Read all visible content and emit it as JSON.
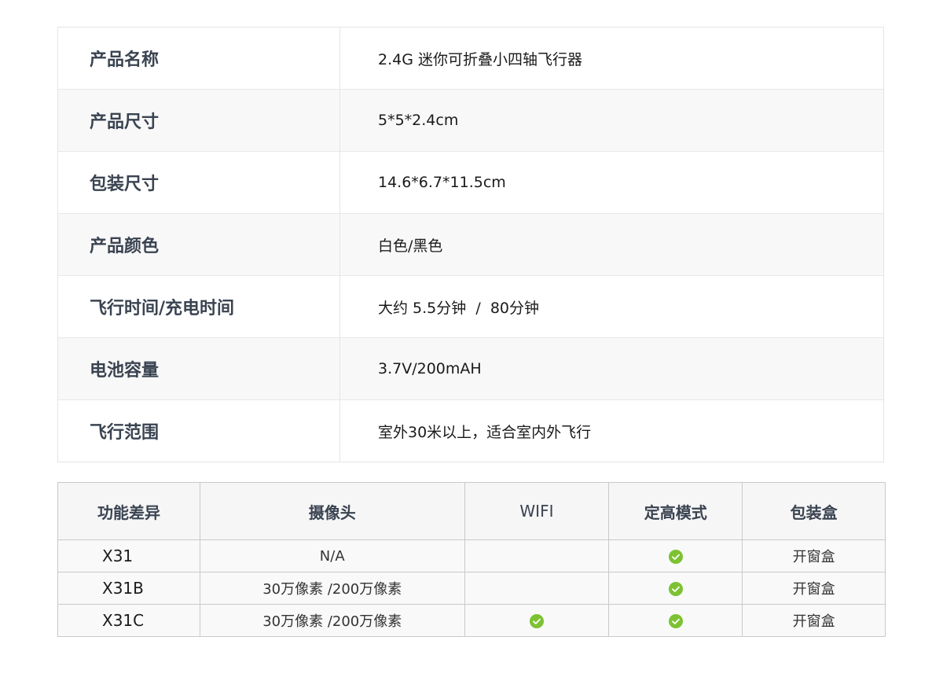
{
  "specs": [
    {
      "label": "产品名称",
      "value": "2.4G 迷你可折叠小四轴飞行器"
    },
    {
      "label": "产品尺寸",
      "value": "5*5*2.4cm"
    },
    {
      "label": "包装尺寸",
      "value": "14.6*6.7*11.5cm"
    },
    {
      "label": "产品颜色",
      "value": "白色/黑色"
    },
    {
      "label": "飞行时间/充电时间",
      "value": "大约 5.5分钟  /  80分钟"
    },
    {
      "label": "电池容量",
      "value": "3.7V/200mAH"
    },
    {
      "label": "飞行范围",
      "value": "室外30米以上，适合室内外飞行"
    }
  ],
  "comparison": {
    "headers": [
      "功能差异",
      "摄像头",
      "WIFI",
      "定高模式",
      "包装盒"
    ],
    "rows": [
      {
        "model": "X31",
        "camera": "N/A",
        "wifi": false,
        "altitude_hold": true,
        "box": "开窗盒"
      },
      {
        "model": "X31B",
        "camera": "30万像素 /200万像素",
        "wifi": false,
        "altitude_hold": true,
        "box": "开窗盒"
      },
      {
        "model": "X31C",
        "camera": "30万像素 /200万像素",
        "wifi": true,
        "altitude_hold": true,
        "box": "开窗盒"
      }
    ],
    "check_icon": "check-circle-icon",
    "check_color": "#7cc232"
  }
}
